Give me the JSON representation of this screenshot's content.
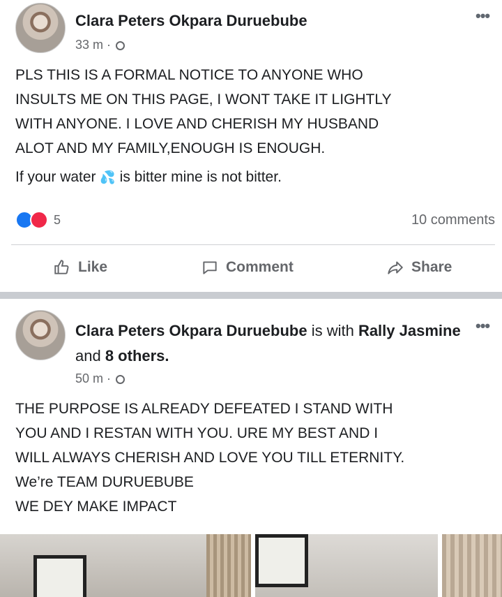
{
  "post1": {
    "author": "Clara Peters Okpara Duruebube",
    "time": "33 m · ",
    "more": "•••",
    "lines": [
      "PLS THIS IS A FORMAL NOTICE TO ANYONE WHO",
      "INSULTS ME ON THIS PAGE, I WONT TAKE IT LIGHTLY",
      "WITH ANYONE. I LOVE AND CHERISH MY HUSBAND",
      "ALOT AND MY FAMILY,ENOUGH IS ENOUGH."
    ],
    "water_line_before": "If your water ",
    "water_emoji": "💦",
    "water_line_after": " is bitter mine is not bitter.",
    "reaction_count": "5",
    "comments": "10 comments",
    "actions": {
      "like": "Like",
      "comment": "Comment",
      "share": "Share"
    }
  },
  "post2": {
    "author": "Clara Peters Okpara Duruebube",
    "with_text": " is with ",
    "tagged": "Rally Jasmine",
    "and_text": " and ",
    "others": "8 others.",
    "time": "50 m · ",
    "more": "•••",
    "lines": [
      "THE PURPOSE IS ALREADY DEFEATED I STAND WITH",
      "YOU AND I RESTAN WITH YOU. URE MY BEST AND I",
      "WILL ALWAYS CHERISH AND LOVE YOU TILL ETERNITY.",
      "We’re TEAM DURUEBUBE",
      "WE DEY MAKE IMPACT"
    ]
  },
  "icons": [
    "globe-icon",
    "more-icon",
    "like-reaction-icon",
    "love-reaction-icon",
    "thumbs-up-icon",
    "comment-icon",
    "share-icon"
  ],
  "colors": {
    "like_blue": "#1877f2",
    "love_red": "#f02849",
    "secondary_text": "#65676b",
    "separator": "#c9ccd1"
  }
}
